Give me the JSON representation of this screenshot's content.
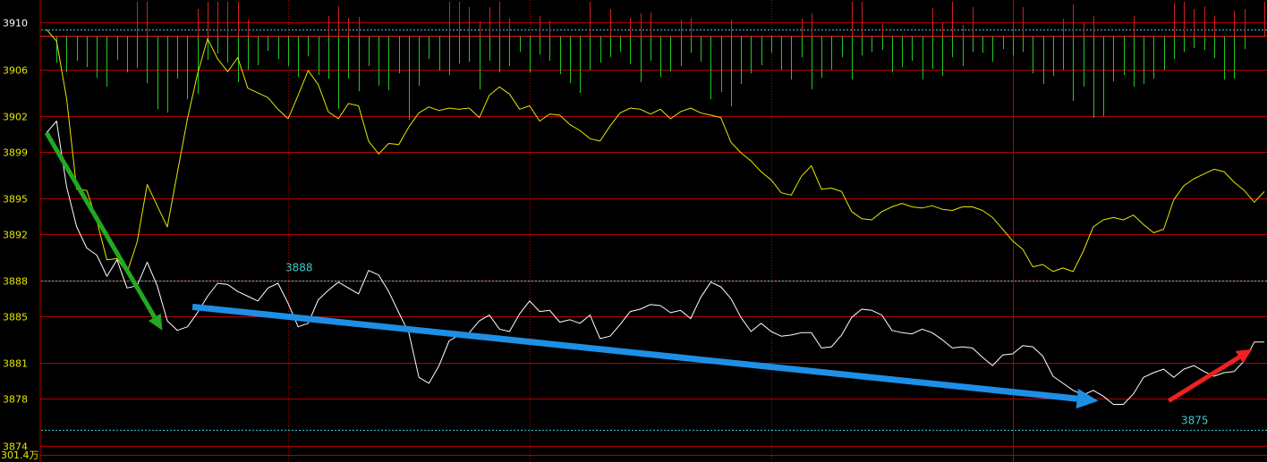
{
  "chart_data": {
    "type": "line",
    "title": "",
    "xlabel": "",
    "ylabel": "",
    "ylim": [
      3872.6,
      3911.9
    ],
    "y_ticks": [
      3910,
      3906,
      3902,
      3899,
      3895,
      3892,
      3888,
      3885,
      3881,
      3878,
      3874
    ],
    "volume_label": "301.4万",
    "reference_lines": [
      {
        "value": 3909.4,
        "color": "#3cc8c8"
      },
      {
        "value": 3888,
        "color": "#3cc8c8"
      },
      {
        "value": 3875.3,
        "color": "#3cc8c8"
      }
    ],
    "annotations": [
      {
        "text": "3888",
        "x": 24,
        "y": 3889.0,
        "color": "#3cc8c8"
      },
      {
        "text": "3875",
        "x": 113,
        "y": 3876.0,
        "color": "#3cc8c8"
      }
    ],
    "x_count": 122,
    "x_dividers": [
      24,
      48,
      72,
      96
    ],
    "series": [
      {
        "color": "#ffffff",
        "values": [
          3900.6,
          3901.6,
          3896,
          3892.6,
          3890.8,
          3890.2,
          3888.4,
          3889.8,
          3887.4,
          3887.6,
          3889.6,
          3887.6,
          3884.6,
          3883.8,
          3884.1,
          3885.3,
          3886.7,
          3887.8,
          3887.7,
          3887.1,
          3886.7,
          3886.3,
          3887.4,
          3887.8,
          3886.1,
          3884.1,
          3884.4,
          3886.4,
          3887.2,
          3887.9,
          3887.4,
          3886.9,
          3888.9,
          3888.5,
          3887.1,
          3885.3,
          3883.6,
          3879.8,
          3879.3,
          3880.8,
          3882.9,
          3883.4,
          3883.6,
          3884.6,
          3885.1,
          3883.9,
          3883.7,
          3885.2,
          3886.3,
          3885.4,
          3885.5,
          3884.5,
          3884.7,
          3884.4,
          3885.1,
          3883.1,
          3883.3,
          3884.3,
          3885.4,
          3885.6,
          3886,
          3885.9,
          3885.3,
          3885.5,
          3884.8,
          3886.6,
          3887.9,
          3887.5,
          3886.5,
          3884.9,
          3883.7,
          3884.4,
          3883.7,
          3883.3,
          3883.4,
          3883.6,
          3883.6,
          3882.3,
          3882.4,
          3883.4,
          3884.9,
          3885.6,
          3885.5,
          3885.1,
          3883.8,
          3883.6,
          3883.5,
          3883.9,
          3883.6,
          3883,
          3882.3,
          3882.4,
          3882.3,
          3881.5,
          3880.8,
          3881.7,
          3881.8,
          3882.5,
          3882.4,
          3881.6,
          3879.9,
          3879.3,
          3878.7,
          3878.3,
          3878.7,
          3878.2,
          3877.5,
          3877.5,
          3878.4,
          3879.8,
          3880.2,
          3880.5,
          3879.8,
          3880.5,
          3880.8,
          3880.3,
          3879.9,
          3880.2,
          3880.3,
          3881.2,
          3882.8,
          3882.8
        ]
      },
      {
        "color": "#e6e600",
        "values": [
          3909.4,
          3908.4,
          3903.5,
          3895.8,
          3895.7,
          3893.1,
          3889.8,
          3889.9,
          3888.7,
          3891.3,
          3896.2,
          3894.4,
          3892.6,
          3897.2,
          3901.8,
          3905.6,
          3908.6,
          3906.9,
          3905.8,
          3907,
          3904.4,
          3904,
          3903.6,
          3902.6,
          3901.8,
          3903.8,
          3905.9,
          3904.7,
          3902.4,
          3901.8,
          3903.1,
          3902.9,
          3899.9,
          3898.8,
          3899.7,
          3899.6,
          3901.1,
          3902.3,
          3902.8,
          3902.5,
          3902.7,
          3902.6,
          3902.7,
          3901.9,
          3903.8,
          3904.5,
          3903.9,
          3902.6,
          3902.9,
          3901.6,
          3902.2,
          3902.1,
          3901.3,
          3900.8,
          3900.1,
          3899.9,
          3901.2,
          3902.3,
          3902.7,
          3902.6,
          3902.2,
          3902.6,
          3901.8,
          3902.4,
          3902.7,
          3902.3,
          3902.1,
          3901.9,
          3899.8,
          3898.9,
          3898.2,
          3897.3,
          3896.6,
          3895.5,
          3895.3,
          3896.9,
          3897.8,
          3895.8,
          3895.9,
          3895.6,
          3893.9,
          3893.3,
          3893.2,
          3893.9,
          3894.3,
          3894.6,
          3894.3,
          3894.2,
          3894.4,
          3894.1,
          3894,
          3894.3,
          3894.3,
          3894,
          3893.4,
          3892.4,
          3891.4,
          3890.7,
          3889.2,
          3889.4,
          3888.8,
          3889.1,
          3888.8,
          3890.5,
          3892.6,
          3893.2,
          3893.4,
          3893.2,
          3893.6,
          3892.8,
          3892.1,
          3892.4,
          3894.9,
          3896.1,
          3896.7,
          3897.1,
          3897.5,
          3897.3,
          3896.4,
          3895.7,
          3894.7,
          3895.6
        ]
      }
    ],
    "volume_bars_up": [
      {
        "x": 9,
        "h": 47
      },
      {
        "x": 10,
        "h": 38
      },
      {
        "x": 15,
        "h": 30
      },
      {
        "x": 16,
        "h": 43
      },
      {
        "x": 17,
        "h": 38
      },
      {
        "x": 18,
        "h": 44
      },
      {
        "x": 19,
        "h": 40
      },
      {
        "x": 20,
        "h": 18
      },
      {
        "x": 28,
        "h": 22
      },
      {
        "x": 29,
        "h": 33
      },
      {
        "x": 30,
        "h": 20
      },
      {
        "x": 31,
        "h": 21
      },
      {
        "x": 40,
        "h": 42
      },
      {
        "x": 41,
        "h": 40
      },
      {
        "x": 42,
        "h": 32
      },
      {
        "x": 43,
        "h": 16
      },
      {
        "x": 44,
        "h": 32
      },
      {
        "x": 45,
        "h": 38
      },
      {
        "x": 46,
        "h": 20
      },
      {
        "x": 49,
        "h": 22
      },
      {
        "x": 50,
        "h": 17
      },
      {
        "x": 54,
        "h": 43
      },
      {
        "x": 56,
        "h": 30
      },
      {
        "x": 58,
        "h": 20
      },
      {
        "x": 59,
        "h": 25
      },
      {
        "x": 60,
        "h": 26
      },
      {
        "x": 63,
        "h": 18
      },
      {
        "x": 64,
        "h": 20
      },
      {
        "x": 68,
        "h": 18
      },
      {
        "x": 75,
        "h": 19
      },
      {
        "x": 76,
        "h": 25
      },
      {
        "x": 80,
        "h": 38
      },
      {
        "x": 81,
        "h": 40
      },
      {
        "x": 83,
        "h": 13
      },
      {
        "x": 88,
        "h": 31
      },
      {
        "x": 89,
        "h": 15
      },
      {
        "x": 90,
        "h": 38
      },
      {
        "x": 91,
        "h": 12
      },
      {
        "x": 92,
        "h": 32
      },
      {
        "x": 96,
        "h": 15
      },
      {
        "x": 97,
        "h": 32
      },
      {
        "x": 101,
        "h": 19
      },
      {
        "x": 102,
        "h": 35
      },
      {
        "x": 103,
        "h": 14
      },
      {
        "x": 104,
        "h": 22
      },
      {
        "x": 108,
        "h": 22
      },
      {
        "x": 112,
        "h": 37
      },
      {
        "x": 113,
        "h": 38
      },
      {
        "x": 114,
        "h": 30
      },
      {
        "x": 115,
        "h": 33
      },
      {
        "x": 116,
        "h": 22
      },
      {
        "x": 118,
        "h": 28
      },
      {
        "x": 119,
        "h": 30
      },
      {
        "x": 121,
        "h": 38
      }
    ],
    "volume_bars_down": [
      {
        "x": 1,
        "h": 30
      },
      {
        "x": 2,
        "h": 41
      },
      {
        "x": 3,
        "h": 28
      },
      {
        "x": 4,
        "h": 35
      },
      {
        "x": 5,
        "h": 47
      },
      {
        "x": 6,
        "h": 57
      },
      {
        "x": 7,
        "h": 27
      },
      {
        "x": 8,
        "h": 41
      },
      {
        "x": 9,
        "h": 36
      },
      {
        "x": 10,
        "h": 53
      },
      {
        "x": 11,
        "h": 82
      },
      {
        "x": 12,
        "h": 86
      },
      {
        "x": 13,
        "h": 48
      },
      {
        "x": 14,
        "h": 71
      },
      {
        "x": 15,
        "h": 65
      },
      {
        "x": 16,
        "h": 27
      },
      {
        "x": 17,
        "h": 20
      },
      {
        "x": 18,
        "h": 30
      },
      {
        "x": 19,
        "h": 52
      },
      {
        "x": 20,
        "h": 38
      },
      {
        "x": 21,
        "h": 33
      },
      {
        "x": 22,
        "h": 17
      },
      {
        "x": 23,
        "h": 26
      },
      {
        "x": 24,
        "h": 34
      },
      {
        "x": 25,
        "h": 46
      },
      {
        "x": 26,
        "h": 23
      },
      {
        "x": 27,
        "h": 44
      },
      {
        "x": 28,
        "h": 48
      },
      {
        "x": 29,
        "h": 82
      },
      {
        "x": 30,
        "h": 48
      },
      {
        "x": 31,
        "h": 62
      },
      {
        "x": 32,
        "h": 34
      },
      {
        "x": 33,
        "h": 56
      },
      {
        "x": 34,
        "h": 61
      },
      {
        "x": 35,
        "h": 42
      },
      {
        "x": 36,
        "h": 94
      },
      {
        "x": 37,
        "h": 56
      },
      {
        "x": 38,
        "h": 26
      },
      {
        "x": 39,
        "h": 39
      },
      {
        "x": 40,
        "h": 44
      },
      {
        "x": 41,
        "h": 31
      },
      {
        "x": 42,
        "h": 29
      },
      {
        "x": 43,
        "h": 60
      },
      {
        "x": 44,
        "h": 28
      },
      {
        "x": 45,
        "h": 41
      },
      {
        "x": 46,
        "h": 34
      },
      {
        "x": 47,
        "h": 18
      },
      {
        "x": 48,
        "h": 41
      },
      {
        "x": 49,
        "h": 21
      },
      {
        "x": 50,
        "h": 28
      },
      {
        "x": 51,
        "h": 43
      },
      {
        "x": 52,
        "h": 53
      },
      {
        "x": 53,
        "h": 64
      },
      {
        "x": 54,
        "h": 38
      },
      {
        "x": 55,
        "h": 30
      },
      {
        "x": 56,
        "h": 24
      },
      {
        "x": 57,
        "h": 18
      },
      {
        "x": 58,
        "h": 32
      },
      {
        "x": 59,
        "h": 52
      },
      {
        "x": 60,
        "h": 28
      },
      {
        "x": 61,
        "h": 46
      },
      {
        "x": 62,
        "h": 40
      },
      {
        "x": 63,
        "h": 34
      },
      {
        "x": 64,
        "h": 19
      },
      {
        "x": 65,
        "h": 29
      },
      {
        "x": 66,
        "h": 71
      },
      {
        "x": 67,
        "h": 63
      },
      {
        "x": 68,
        "h": 79
      },
      {
        "x": 69,
        "h": 54
      },
      {
        "x": 70,
        "h": 42
      },
      {
        "x": 71,
        "h": 33
      },
      {
        "x": 72,
        "h": 19
      },
      {
        "x": 73,
        "h": 38
      },
      {
        "x": 74,
        "h": 49
      },
      {
        "x": 75,
        "h": 24
      },
      {
        "x": 76,
        "h": 60
      },
      {
        "x": 77,
        "h": 47
      },
      {
        "x": 78,
        "h": 38
      },
      {
        "x": 79,
        "h": 24
      },
      {
        "x": 80,
        "h": 49
      },
      {
        "x": 81,
        "h": 22
      },
      {
        "x": 82,
        "h": 18
      },
      {
        "x": 83,
        "h": 16
      },
      {
        "x": 84,
        "h": 41
      },
      {
        "x": 85,
        "h": 35
      },
      {
        "x": 86,
        "h": 28
      },
      {
        "x": 87,
        "h": 49
      },
      {
        "x": 88,
        "h": 37
      },
      {
        "x": 89,
        "h": 45
      },
      {
        "x": 90,
        "h": 24
      },
      {
        "x": 91,
        "h": 34
      },
      {
        "x": 92,
        "h": 18
      },
      {
        "x": 93,
        "h": 19
      },
      {
        "x": 94,
        "h": 29
      },
      {
        "x": 95,
        "h": 15
      },
      {
        "x": 96,
        "h": 22
      },
      {
        "x": 97,
        "h": 18
      },
      {
        "x": 98,
        "h": 42
      },
      {
        "x": 99,
        "h": 54
      },
      {
        "x": 100,
        "h": 45
      },
      {
        "x": 101,
        "h": 38
      },
      {
        "x": 102,
        "h": 73
      },
      {
        "x": 103,
        "h": 57
      },
      {
        "x": 104,
        "h": 92
      },
      {
        "x": 105,
        "h": 90
      },
      {
        "x": 106,
        "h": 51
      },
      {
        "x": 107,
        "h": 44
      },
      {
        "x": 108,
        "h": 57
      },
      {
        "x": 109,
        "h": 54
      },
      {
        "x": 110,
        "h": 48
      },
      {
        "x": 111,
        "h": 38
      },
      {
        "x": 112,
        "h": 26
      },
      {
        "x": 113,
        "h": 18
      },
      {
        "x": 114,
        "h": 14
      },
      {
        "x": 115,
        "h": 16
      },
      {
        "x": 116,
        "h": 25
      },
      {
        "x": 117,
        "h": 49
      },
      {
        "x": 118,
        "h": 48
      },
      {
        "x": 119,
        "h": 15
      }
    ],
    "arrows": [
      {
        "color": "#22a822",
        "from": [
          0,
          3900.6
        ],
        "to": [
          11.5,
          3883.8
        ],
        "width": 5
      },
      {
        "color": "#1e8fe6",
        "from": [
          14.5,
          3885.8
        ],
        "to": [
          104.5,
          3877.8
        ],
        "width": 7
      },
      {
        "color": "#ee2222",
        "from": [
          111.5,
          3877.8
        ],
        "to": [
          119.8,
          3882.2
        ],
        "width": 5
      }
    ],
    "colors": {
      "background": "#000000",
      "grid": "#b40000",
      "tick_label": "#ffffff",
      "tick_label_alt": "#e6e600",
      "volume_up": "#d22020",
      "volume_down": "#22c822"
    }
  }
}
